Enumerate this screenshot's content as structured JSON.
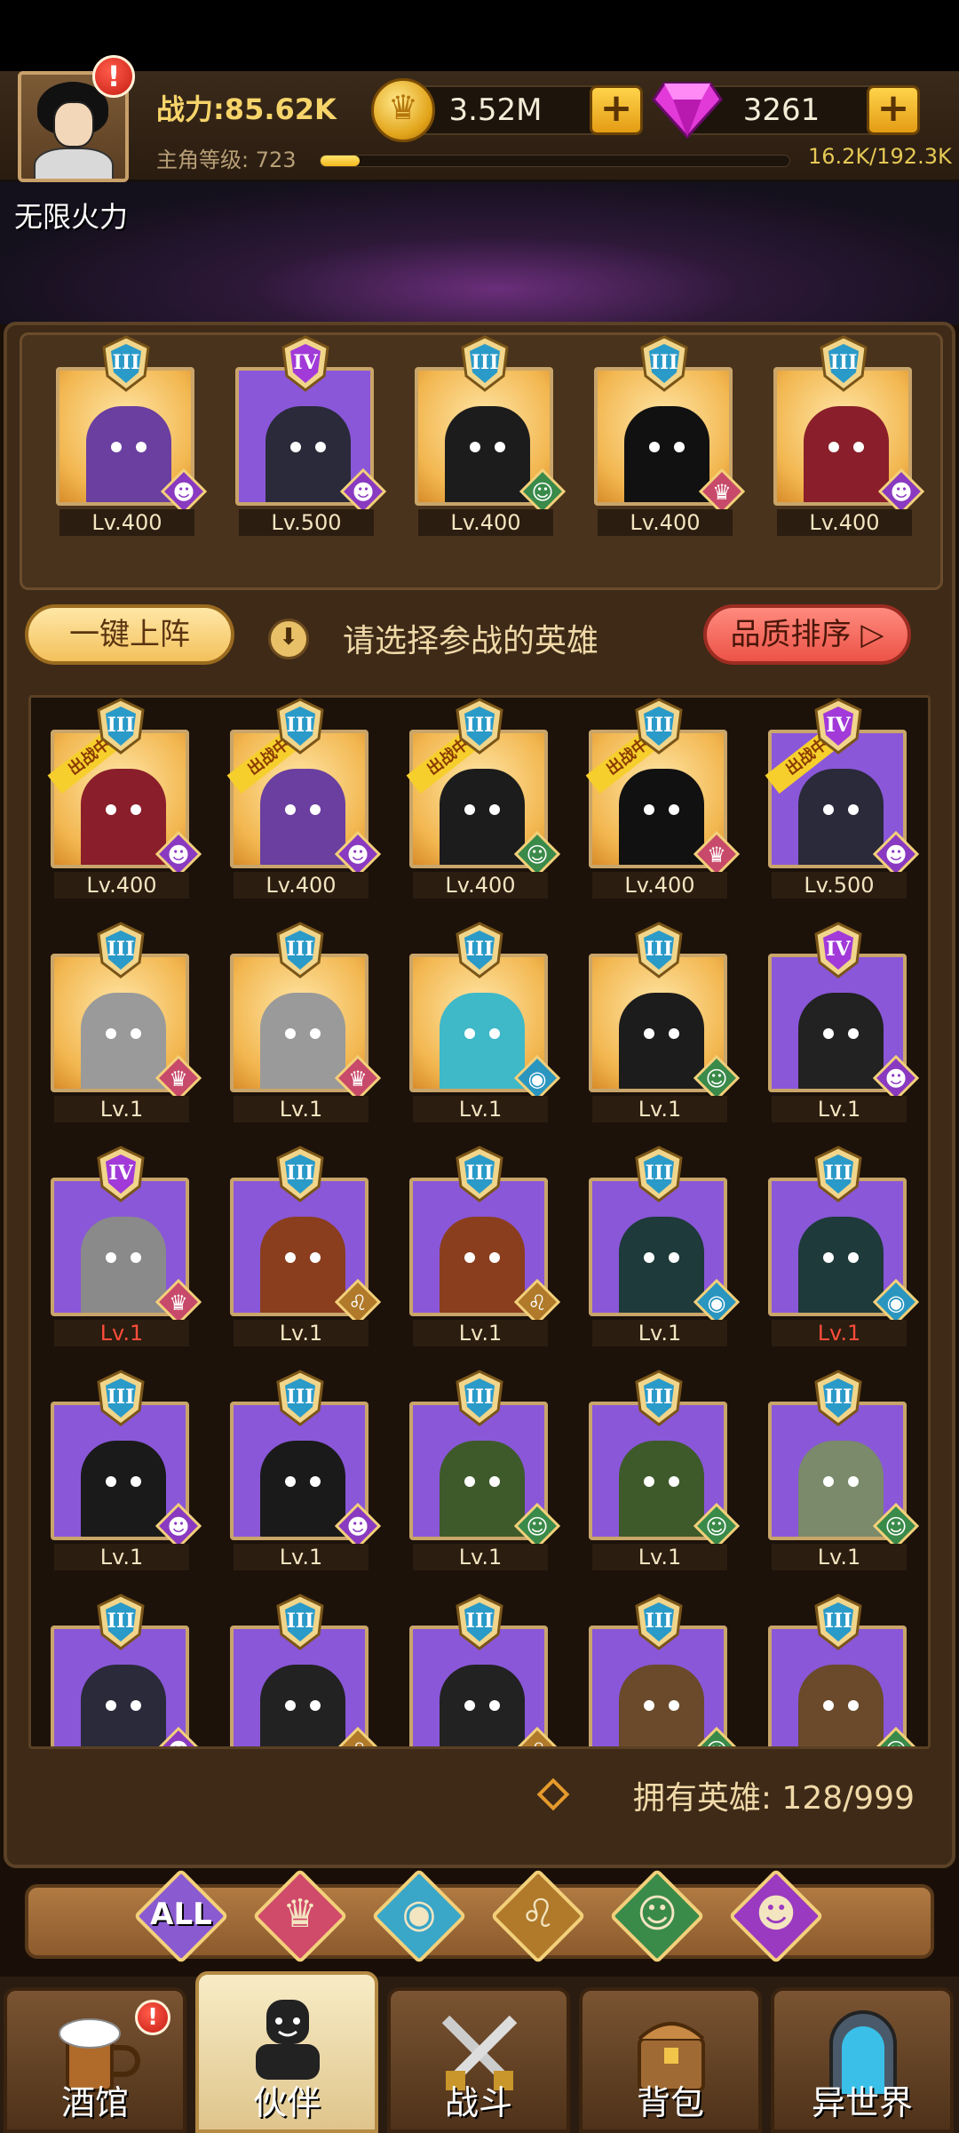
{
  "hud": {
    "power": "战力:85.62K",
    "level_label": "主角等级:  723",
    "exp_text": "16.2K/192.3K",
    "exp_fraction": 0.0842,
    "gold": "3.52M",
    "gems": "3261",
    "alert": "!"
  },
  "scene": {
    "title": "无限火力"
  },
  "lineup": [
    {
      "level": "Lv.400",
      "rank": "III",
      "bg": "gold",
      "body": "#6a3fa0",
      "faction": "demon"
    },
    {
      "level": "Lv.500",
      "rank": "IV",
      "bg": "purple",
      "body": "#2a2a3a",
      "faction": "demon"
    },
    {
      "level": "Lv.400",
      "rank": "III",
      "bg": "gold",
      "body": "#1c1c1c",
      "faction": "elf"
    },
    {
      "level": "Lv.400",
      "rank": "III",
      "bg": "gold",
      "body": "#111111",
      "faction": "crown"
    },
    {
      "level": "Lv.400",
      "rank": "III",
      "bg": "gold",
      "body": "#8a1e2a",
      "faction": "demon"
    }
  ],
  "actions": {
    "one_key": "一键上阵",
    "hint": "请选择参战的英雄",
    "sort": "品质排序 ▷"
  },
  "deployed_label": "出战中",
  "roster": [
    {
      "level": "Lv.400",
      "rank": "III",
      "bg": "gold",
      "body": "#8a1e2a",
      "faction": "demon",
      "deployed": true,
      "red": false
    },
    {
      "level": "Lv.400",
      "rank": "III",
      "bg": "gold",
      "body": "#6a3fa0",
      "faction": "demon",
      "deployed": true,
      "red": false
    },
    {
      "level": "Lv.400",
      "rank": "III",
      "bg": "gold",
      "body": "#1c1c1c",
      "faction": "elf",
      "deployed": true,
      "red": false
    },
    {
      "level": "Lv.400",
      "rank": "III",
      "bg": "gold",
      "body": "#111111",
      "faction": "crown",
      "deployed": true,
      "red": false
    },
    {
      "level": "Lv.500",
      "rank": "IV",
      "bg": "purple",
      "body": "#2a2a3a",
      "faction": "demon",
      "deployed": true,
      "red": false
    },
    {
      "level": "Lv.1",
      "rank": "III",
      "bg": "gold",
      "body": "#9a9a9a",
      "faction": "crown",
      "deployed": false,
      "red": false
    },
    {
      "level": "Lv.1",
      "rank": "III",
      "bg": "gold",
      "body": "#9a9a9a",
      "faction": "crown",
      "deployed": false,
      "red": false
    },
    {
      "level": "Lv.1",
      "rank": "III",
      "bg": "gold",
      "body": "#3fb8c8",
      "faction": "fish",
      "deployed": false,
      "red": false
    },
    {
      "level": "Lv.1",
      "rank": "III",
      "bg": "gold",
      "body": "#1c1c1c",
      "faction": "elf",
      "deployed": false,
      "red": false
    },
    {
      "level": "Lv.1",
      "rank": "IV",
      "bg": "purple",
      "body": "#222222",
      "faction": "demon",
      "deployed": false,
      "red": false
    },
    {
      "level": "Lv.1",
      "rank": "IV",
      "bg": "purple",
      "body": "#8a8a8a",
      "faction": "crown",
      "deployed": false,
      "red": true
    },
    {
      "level": "Lv.1",
      "rank": "III",
      "bg": "purple",
      "body": "#8a3e1e",
      "faction": "lion",
      "deployed": false,
      "red": false
    },
    {
      "level": "Lv.1",
      "rank": "III",
      "bg": "purple",
      "body": "#8a3e1e",
      "faction": "lion",
      "deployed": false,
      "red": false
    },
    {
      "level": "Lv.1",
      "rank": "III",
      "bg": "purple",
      "body": "#1e3a3a",
      "faction": "fish",
      "deployed": false,
      "red": false
    },
    {
      "level": "Lv.1",
      "rank": "III",
      "bg": "purple",
      "body": "#1e3a3a",
      "faction": "fish",
      "deployed": false,
      "red": true
    },
    {
      "level": "Lv.1",
      "rank": "III",
      "bg": "purple",
      "body": "#1a1a1a",
      "faction": "demon",
      "deployed": false,
      "red": false
    },
    {
      "level": "Lv.1",
      "rank": "III",
      "bg": "purple",
      "body": "#1a1a1a",
      "faction": "demon",
      "deployed": false,
      "red": false
    },
    {
      "level": "Lv.1",
      "rank": "III",
      "bg": "purple",
      "body": "#3e5a2a",
      "faction": "elf",
      "deployed": false,
      "red": false
    },
    {
      "level": "Lv.1",
      "rank": "III",
      "bg": "purple",
      "body": "#3e5a2a",
      "faction": "elf",
      "deployed": false,
      "red": false
    },
    {
      "level": "Lv.1",
      "rank": "III",
      "bg": "purple",
      "body": "#7a8a6a",
      "faction": "elf",
      "deployed": false,
      "red": false
    },
    {
      "level": "",
      "rank": "III",
      "bg": "purple",
      "body": "#2a2a3a",
      "faction": "demon",
      "deployed": false,
      "red": false
    },
    {
      "level": "",
      "rank": "III",
      "bg": "purple",
      "body": "#222222",
      "faction": "lion",
      "deployed": false,
      "red": false
    },
    {
      "level": "",
      "rank": "III",
      "bg": "purple",
      "body": "#222222",
      "faction": "lion",
      "deployed": false,
      "red": false
    },
    {
      "level": "",
      "rank": "III",
      "bg": "purple",
      "body": "#6a4a2a",
      "faction": "elf",
      "deployed": false,
      "red": false
    },
    {
      "level": "",
      "rank": "III",
      "bg": "purple",
      "body": "#6a4a2a",
      "faction": "elf",
      "deployed": false,
      "red": false
    }
  ],
  "owned": "拥有英雄:  128/999",
  "filters": [
    {
      "label": "ALL",
      "color": "#8a5ad0",
      "glyph": "",
      "icon": "all-filter"
    },
    {
      "label": "",
      "color": "#d04a6a",
      "glyph": "♛",
      "icon": "crown-faction-icon"
    },
    {
      "label": "",
      "color": "#3aa6c8",
      "glyph": "◉",
      "icon": "fish-faction-icon"
    },
    {
      "label": "",
      "color": "#b07a2a",
      "glyph": "♌",
      "icon": "lion-faction-icon"
    },
    {
      "label": "",
      "color": "#3a8a4a",
      "glyph": "☺",
      "icon": "elf-faction-icon"
    },
    {
      "label": "",
      "color": "#9a3ac0",
      "glyph": "☻",
      "icon": "demon-faction-icon"
    }
  ],
  "nav": [
    {
      "label": "酒馆",
      "icon": "beer-mug-icon",
      "active": false,
      "alert": true
    },
    {
      "label": "伙伴",
      "icon": "partner-icon",
      "active": true,
      "alert": false
    },
    {
      "label": "战斗",
      "icon": "crossed-swords-icon",
      "active": false,
      "alert": false
    },
    {
      "label": "背包",
      "icon": "chest-icon",
      "active": false,
      "alert": false
    },
    {
      "label": "异世界",
      "icon": "portal-icon",
      "active": false,
      "alert": false
    }
  ],
  "colors": {
    "gold_frame": "#c9a56a",
    "purple_bg": "#8a57d8",
    "accent_red": "#ff4d3a",
    "deployed_tag": "#f6cf2d"
  }
}
